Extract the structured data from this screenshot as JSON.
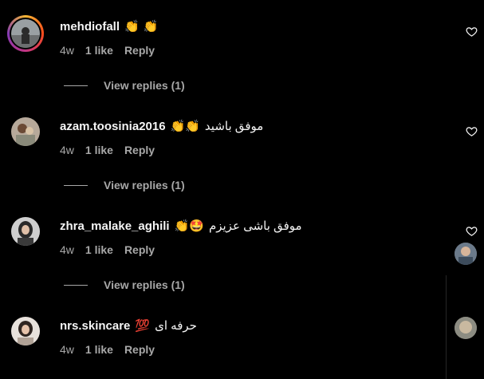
{
  "comments": [
    {
      "username": "mehdiofall",
      "text": "",
      "emoji": "👏 👏",
      "time": "4w",
      "likes": "1 like",
      "reply": "Reply",
      "view_replies": "View replies (1)"
    },
    {
      "username": "azam.toosinia2016",
      "text": "موفق باشید",
      "emoji": "👏👏",
      "time": "4w",
      "likes": "1 like",
      "reply": "Reply",
      "view_replies": "View replies (1)"
    },
    {
      "username": "zhra_malake_aghili",
      "text": "موفق باشی عزیزم",
      "emoji": "👏🤩",
      "time": "4w",
      "likes": "1 like",
      "reply": "Reply",
      "view_replies": "View replies (1)"
    },
    {
      "username": "nrs.skincare",
      "text": "حرفه ای",
      "emoji": "💯",
      "time": "4w",
      "likes": "1 like",
      "reply": "Reply"
    }
  ],
  "icons": {
    "like": "heart-outline-icon"
  },
  "colors": {
    "background": "#000000",
    "text": "#f5f5f5",
    "secondary": "#a8a8a8",
    "story_ring": "#c13584"
  }
}
